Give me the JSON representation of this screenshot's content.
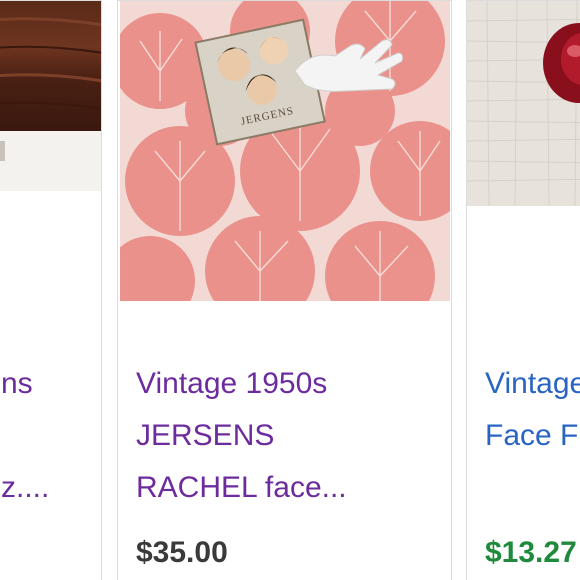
{
  "listings": [
    {
      "title_lines": [
        "ns",
        "",
        "z...."
      ],
      "price": "",
      "image_icon": "wood-surface-photo"
    },
    {
      "title_lines": [
        "Vintage 1950s",
        "JERSENS",
        "RACHEL face..."
      ],
      "price": "$35.00",
      "image_icon": "jergens-compact-on-coral-fabric-photo",
      "image_text": "JERGENS"
    },
    {
      "title_lines": [
        "Vintage",
        "Face F"
      ],
      "price": "$13.27",
      "image_icon": "red-glass-dish-photo"
    }
  ],
  "colors": {
    "visited_title": "#6d2c9e",
    "link_title": "#2a64c2",
    "price_default": "#3a3a3a",
    "price_discount": "#1f8a3b",
    "card_border": "#dcdcdc"
  }
}
